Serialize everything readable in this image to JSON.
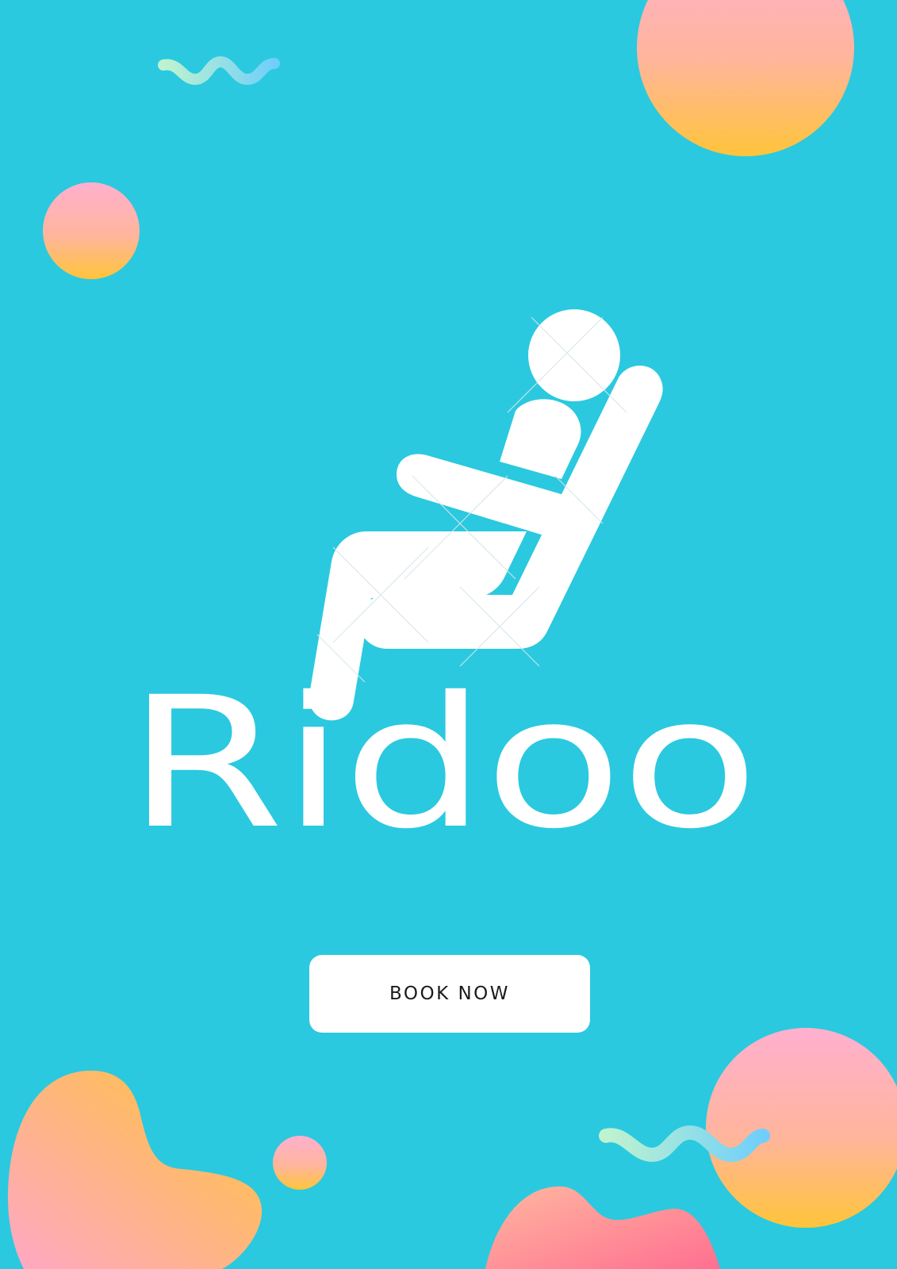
{
  "brand": {
    "name": "Ridoo",
    "icon": "reclining-seat-person-icon"
  },
  "cta": {
    "label": "BOOK NOW"
  },
  "colors": {
    "background": "#2ac9df",
    "text": "#ffffff",
    "button": "#ffffff",
    "button_text": "#1b1b1b",
    "gradient_pink": "#ffb0d0",
    "gradient_yellow": "#ffc23c",
    "gradient_coral": "#ff6f8e",
    "squiggle_green": "#b8f0d4",
    "squiggle_blue": "#72d0f8"
  }
}
